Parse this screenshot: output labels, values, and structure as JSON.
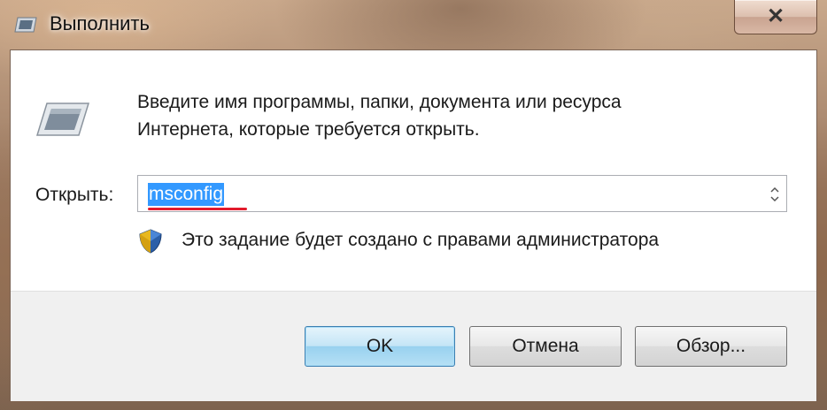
{
  "window": {
    "title": "Выполнить",
    "close_symbol": "✕"
  },
  "dialog": {
    "description_line1": "Введите имя программы, папки, документа или ресурса",
    "description_line2": "Интернета, которые требуется открыть.",
    "open_label": "Открыть:",
    "open_value": "msconfig",
    "admin_note": "Это задание будет создано с правами администратора"
  },
  "buttons": {
    "ok": "OK",
    "cancel": "Отмена",
    "browse": "Обзор..."
  },
  "icons": {
    "title": "run-icon",
    "program": "run-program-icon",
    "shield": "uac-shield-icon",
    "dropdown": "updown-arrows-icon"
  },
  "colors": {
    "selection": "#3399ff",
    "underline": "#e21b2c",
    "ok_button": "#c4e5f6"
  }
}
